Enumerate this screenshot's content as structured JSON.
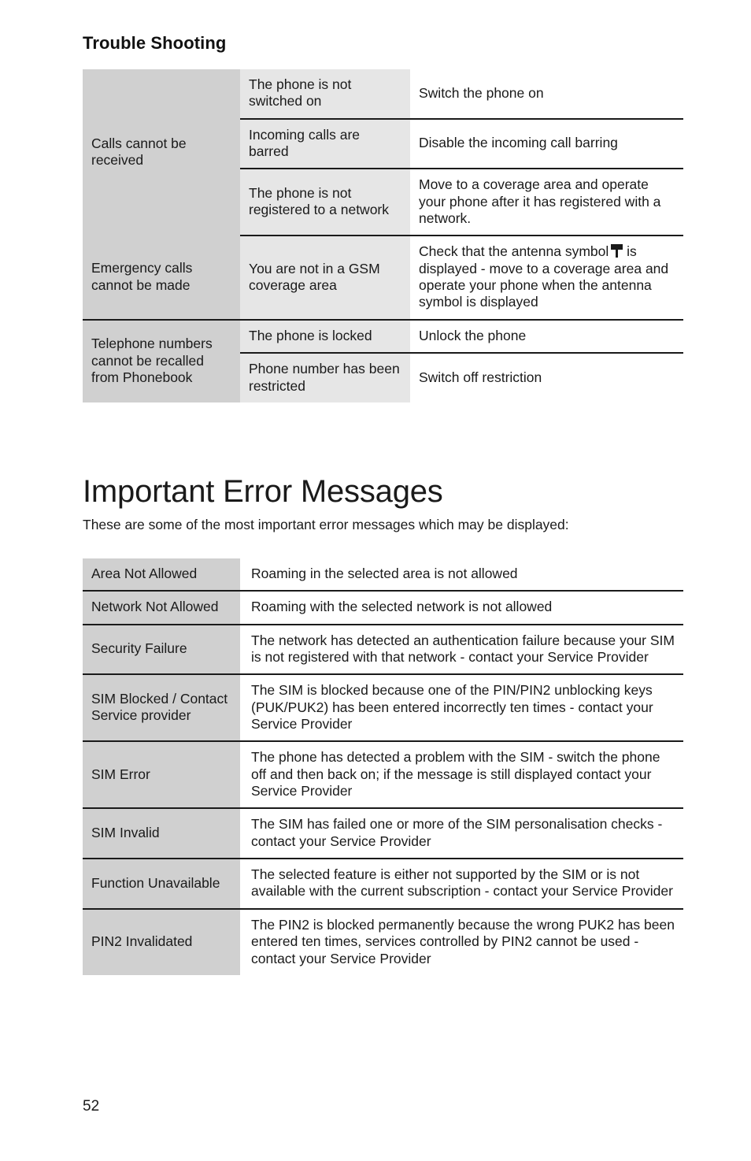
{
  "section_title": "Trouble Shooting",
  "chapter_title": "Important Error Messages",
  "intro_paragraph": "These are some of the most important error messages which may be displayed:",
  "page_number": "52",
  "colors": {
    "symptom_cell": "#d0d0d0",
    "cause_cell": "#e6e6e6",
    "remedy_cell": "#ffffff",
    "rule": "#1a1a1a",
    "text": "#1a1a1a",
    "page_background": "#ffffff"
  },
  "icons": {
    "antenna": "antenna-icon"
  },
  "troubleshooting_table": {
    "groups": [
      {
        "symptom": "Calls cannot be received",
        "rows": [
          {
            "cause": "The phone is not switched on",
            "remedy": "Switch the phone on"
          },
          {
            "cause": "Incoming calls are barred",
            "remedy": "Disable the incoming call barring"
          },
          {
            "cause": "The phone is not registered to a network",
            "remedy": "Move to a coverage area and operate your phone after it has registered with a network."
          }
        ]
      },
      {
        "symptom": "Emergency calls cannot be made",
        "rows": [
          {
            "cause": "You are not in a GSM coverage area",
            "remedy_part1": "Check that the antenna symbol",
            "remedy_part2": "is displayed - move to a coverage area and operate your phone when the antenna symbol is displayed"
          }
        ]
      },
      {
        "symptom": "Telephone numbers cannot be recalled from Phonebook",
        "rows": [
          {
            "cause": "The phone is locked",
            "remedy": "Unlock the phone"
          },
          {
            "cause": "Phone number has been restricted",
            "remedy": "Switch off restriction"
          }
        ]
      }
    ]
  },
  "error_messages_table": {
    "rows": [
      {
        "message": "Area Not Allowed",
        "description": "Roaming in the selected area is not allowed"
      },
      {
        "message": "Network Not Allowed",
        "description": "Roaming with the selected network is not allowed"
      },
      {
        "message": "Security Failure",
        "description": "The network has detected an authentication failure because your SIM is not registered with that network - contact your Service Provider"
      },
      {
        "message": "SIM Blocked / Contact Service provider",
        "description": "The SIM is blocked because one of the PIN/PIN2 unblocking keys (PUK/PUK2) has been entered incorrectly ten times - contact your Service Provider"
      },
      {
        "message": "SIM Error",
        "description": "The phone has detected a problem with the SIM - switch the phone off and then back on; if the message is still displayed contact your Service Provider"
      },
      {
        "message": "SIM Invalid",
        "description": "The SIM has failed one or more of the SIM personalisation checks - contact your Service Provider"
      },
      {
        "message": "Function Unavailable",
        "description": "The selected feature is either not supported by the SIM or is not available with the current subscription - contact your Service Provider"
      },
      {
        "message": "PIN2 Invalidated",
        "description": "The PIN2 is blocked permanently because the wrong PUK2 has been entered ten times, services controlled by PIN2 cannot be used - contact your Service Provider"
      }
    ]
  }
}
